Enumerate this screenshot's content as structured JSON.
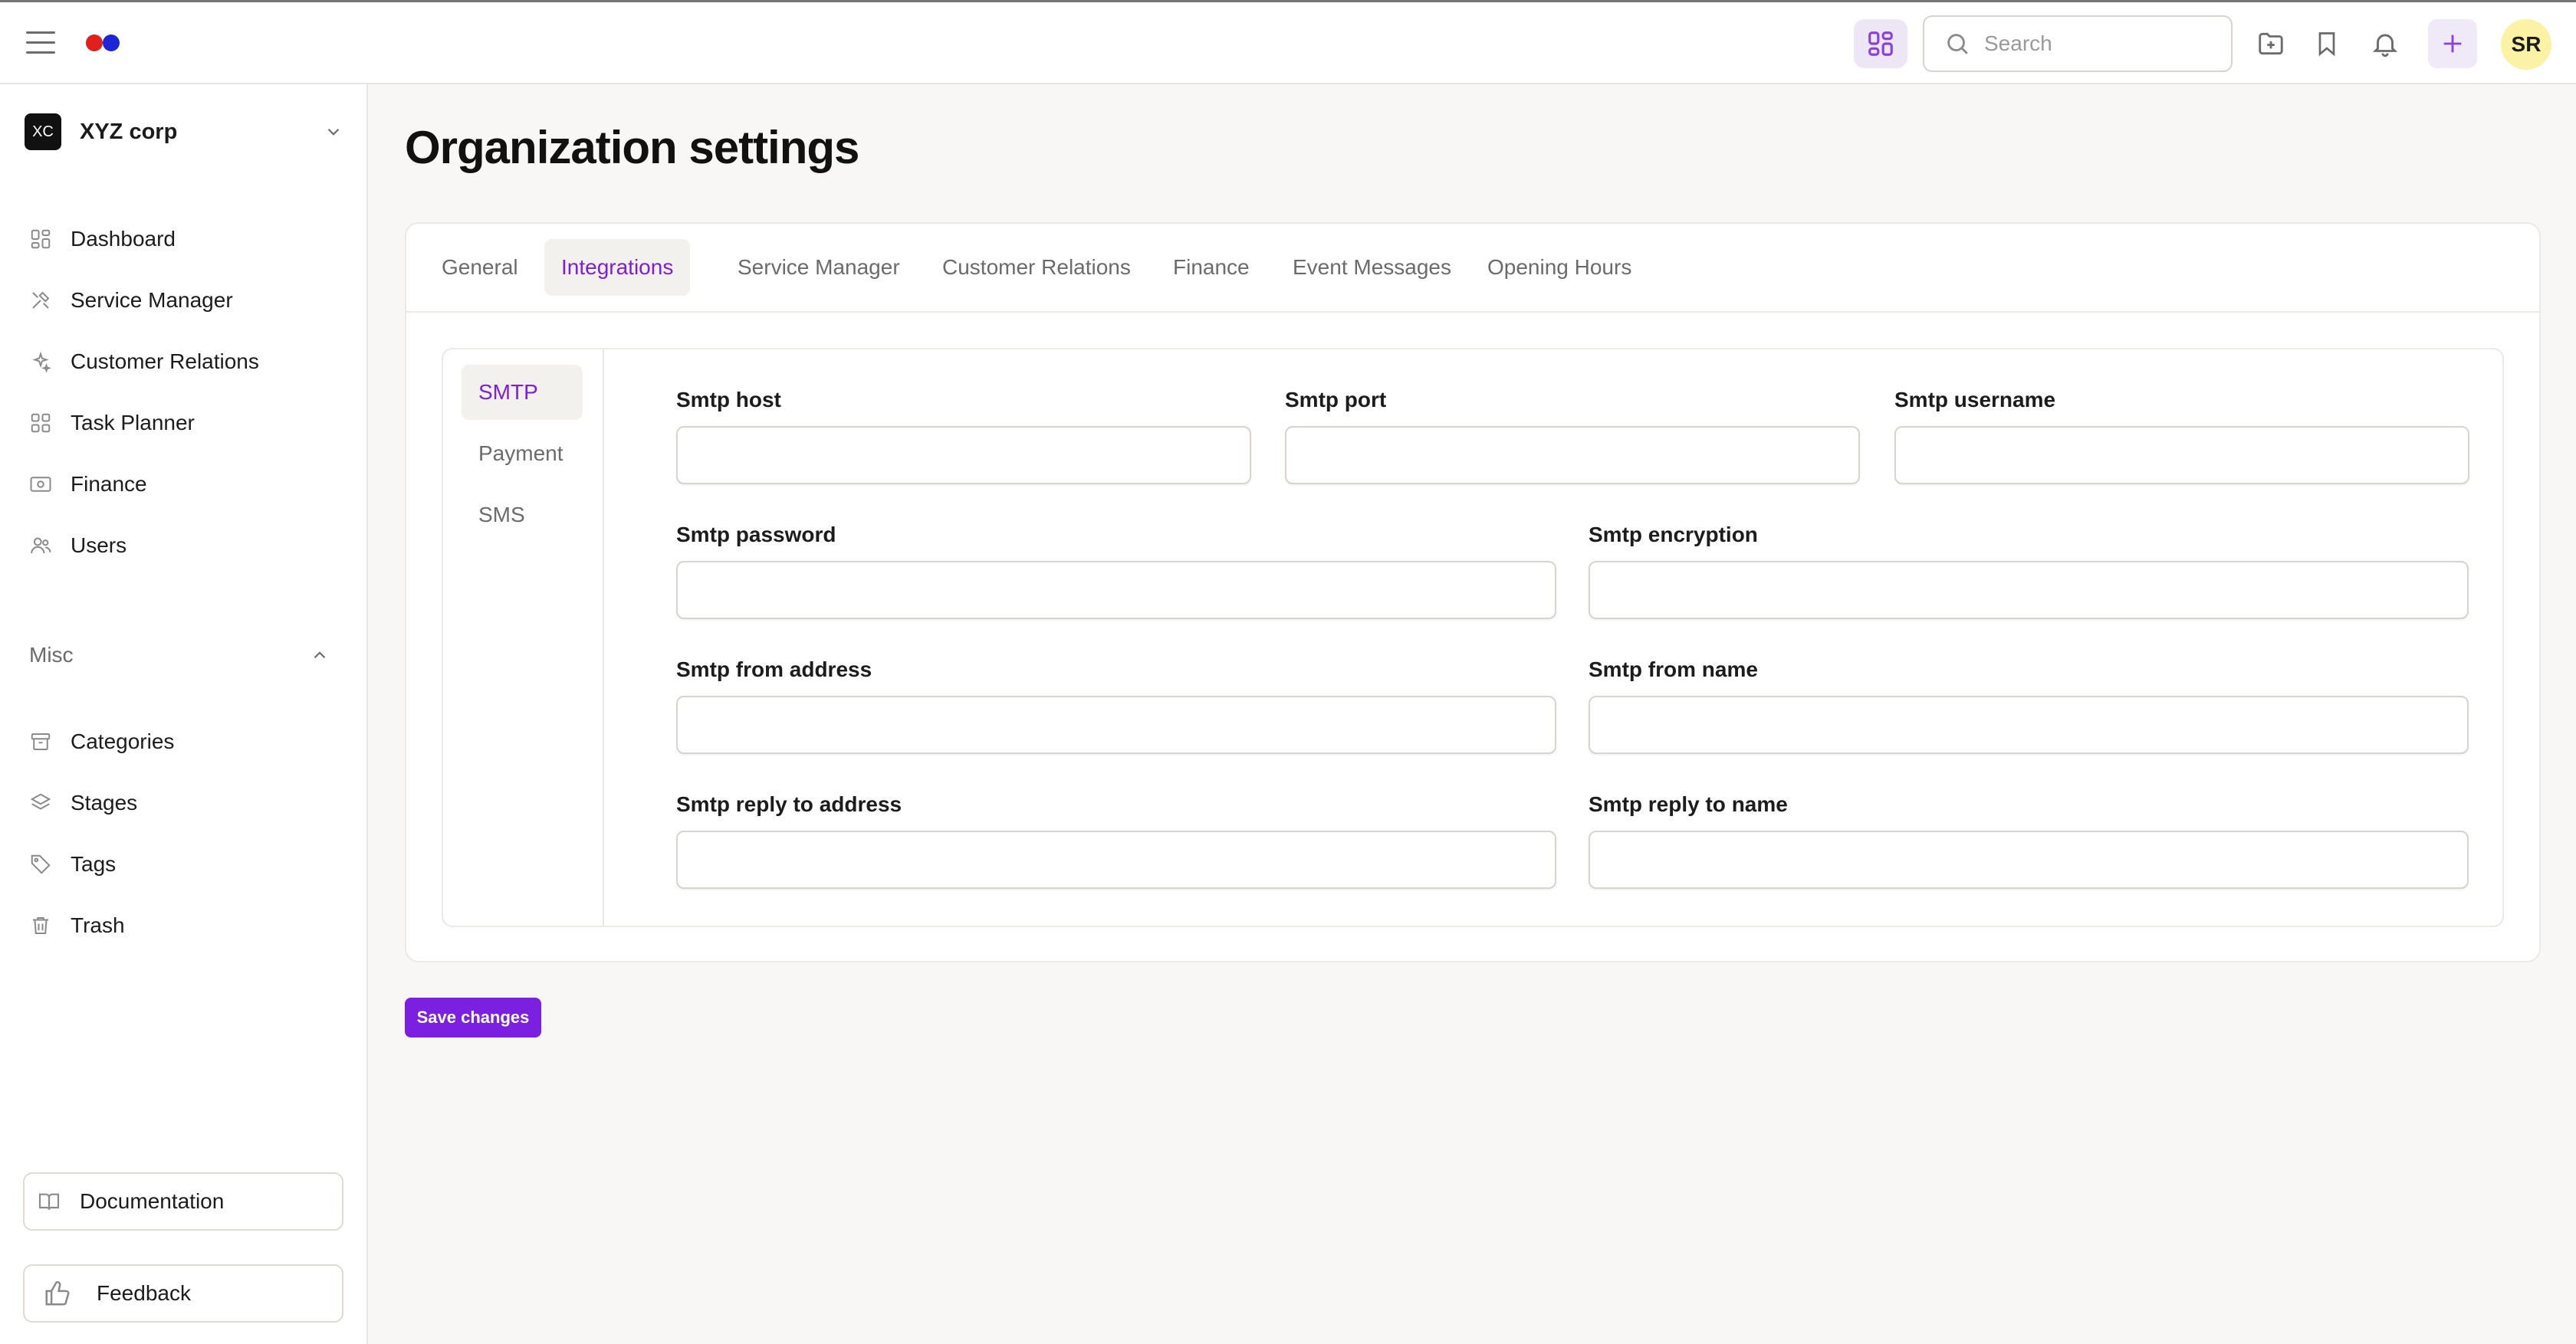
{
  "topbar": {
    "search_placeholder": "Search",
    "avatar_initials": "SR",
    "icons": [
      "menu-icon",
      "apps-icon",
      "search-icon",
      "folder-plus-icon",
      "bookmark-icon",
      "bell-icon",
      "plus-icon"
    ]
  },
  "sidebar": {
    "org": {
      "badge": "XC",
      "name": "XYZ corp"
    },
    "items": [
      {
        "label": "Dashboard",
        "icon": "dashboard-icon"
      },
      {
        "label": "Service Manager",
        "icon": "tools-icon"
      },
      {
        "label": "Customer Relations",
        "icon": "sparkle-icon"
      },
      {
        "label": "Task Planner",
        "icon": "grid-icon"
      },
      {
        "label": "Finance",
        "icon": "money-icon"
      },
      {
        "label": "Users",
        "icon": "users-icon"
      }
    ],
    "misc_label": "Misc",
    "misc_items": [
      {
        "label": "Categories",
        "icon": "archive-icon"
      },
      {
        "label": "Stages",
        "icon": "layers-icon"
      },
      {
        "label": "Tags",
        "icon": "tag-icon"
      },
      {
        "label": "Trash",
        "icon": "trash-icon"
      }
    ],
    "documentation": "Documentation",
    "feedback": "Feedback"
  },
  "main": {
    "title": "Organization settings",
    "tabs": [
      {
        "label": "General"
      },
      {
        "label": "Integrations",
        "active": true
      },
      {
        "label": "Service Manager"
      },
      {
        "label": "Customer Relations"
      },
      {
        "label": "Finance"
      },
      {
        "label": "Event Messages"
      },
      {
        "label": "Opening Hours"
      }
    ],
    "subtabs": [
      {
        "label": "SMTP",
        "active": true
      },
      {
        "label": "Payment"
      },
      {
        "label": "SMS"
      }
    ],
    "fields": {
      "host": {
        "label": "Smtp host",
        "value": ""
      },
      "port": {
        "label": "Smtp port",
        "value": ""
      },
      "username": {
        "label": "Smtp username",
        "value": ""
      },
      "password": {
        "label": "Smtp password",
        "value": ""
      },
      "encryption": {
        "label": "Smtp encryption",
        "value": ""
      },
      "from_address": {
        "label": "Smtp from address",
        "value": ""
      },
      "from_name": {
        "label": "Smtp from name",
        "value": ""
      },
      "reply_to_address": {
        "label": "Smtp reply to address",
        "value": ""
      },
      "reply_to_name": {
        "label": "Smtp reply to name",
        "value": ""
      }
    },
    "save_label": "Save changes"
  },
  "colors": {
    "accent": "#7b1fe0",
    "accent_text": "#7b1fd8",
    "logo_red": "#e0201c",
    "logo_blue": "#1d25d6",
    "avatar_bg": "#fbf2a6"
  }
}
